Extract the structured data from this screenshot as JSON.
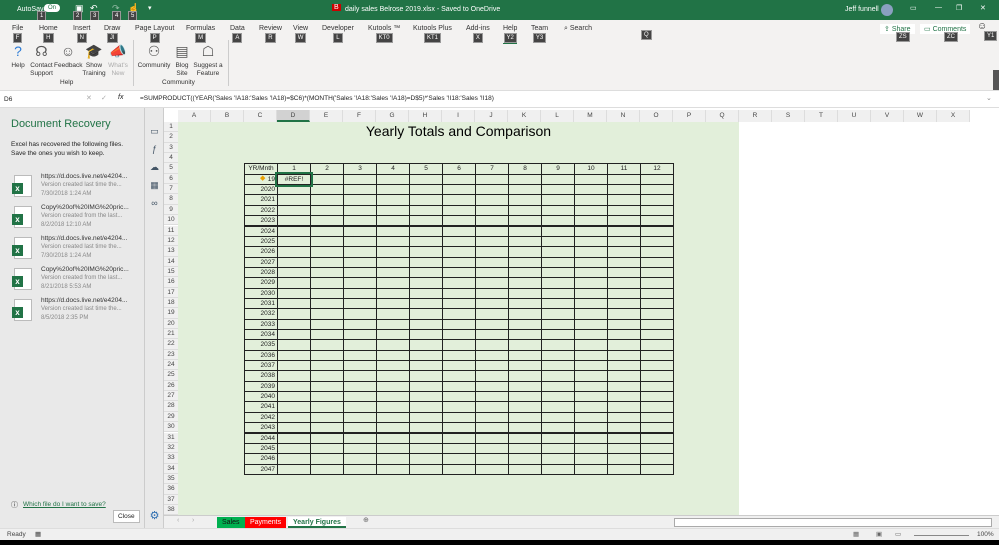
{
  "titlebar": {
    "autosave": "AutoSave",
    "autosave_state": "On",
    "doc_title": "daily sales Belrose 2019.xlsx - Saved to OneDrive",
    "user": "Jeff funnell",
    "keytips": [
      "1",
      "2",
      "3",
      "4",
      "5"
    ]
  },
  "ribbon": {
    "tabs": [
      {
        "label": "File",
        "key": "F"
      },
      {
        "label": "Home",
        "key": "H"
      },
      {
        "label": "Insert",
        "key": "N"
      },
      {
        "label": "Draw",
        "key": "JI"
      },
      {
        "label": "Page Layout",
        "key": "P"
      },
      {
        "label": "Formulas",
        "key": "M"
      },
      {
        "label": "Data",
        "key": "A"
      },
      {
        "label": "Review",
        "key": "R"
      },
      {
        "label": "View",
        "key": "W"
      },
      {
        "label": "Developer",
        "key": "L"
      },
      {
        "label": "Kutools ™",
        "key": "KT0"
      },
      {
        "label": "Kutools Plus",
        "key": "KT1"
      },
      {
        "label": "Add-ins",
        "key": "X"
      },
      {
        "label": "Help",
        "key": "Y2"
      },
      {
        "label": "Team",
        "key": "Y3"
      }
    ],
    "search": "Search",
    "search_key": "Q",
    "share": "Share",
    "share_key": "ZS",
    "comments": "Comments",
    "comments_key": "ZC",
    "smiley_key": "Y1",
    "help_group": {
      "label": "Help",
      "buttons": [
        "Help",
        "Contact Support",
        "Feedback",
        "Show Training",
        "What's New"
      ]
    },
    "community_group": {
      "label": "Community",
      "buttons": [
        "Community",
        "Blog Site",
        "Suggest a Feature"
      ]
    }
  },
  "formula_bar": {
    "name_box": "D6",
    "formula": "=SUMPRODUCT((YEAR('Sales '!A18:'Sales '!A18)=$C6)*(MONTH('Sales '!A18:'Sales '!A18)=D$5)*'Sales '!I18:'Sales '!I18)"
  },
  "recovery": {
    "title": "Document Recovery",
    "message": "Excel has recovered the following files.  Save the ones you wish to keep.",
    "files": [
      {
        "name": "https://d.docs.live.net/e4204...",
        "desc": "Version created last time the...",
        "time": "7/30/2018 1:24 AM"
      },
      {
        "name": "Copy%20of%20IMG%20pric...",
        "desc": "Version created from the last...",
        "time": "8/2/2018 12:10 AM"
      },
      {
        "name": "https://d.docs.live.net/e4204...",
        "desc": "Version created last time the...",
        "time": "7/30/2018 1:24 AM"
      },
      {
        "name": "Copy%20of%20IMG%20pric...",
        "desc": "Version created from the last...",
        "time": "8/21/2018 5:53 AM"
      },
      {
        "name": "https://d.docs.live.net/e4204...",
        "desc": "Version created last time the...",
        "time": "8/5/2018 2:35 PM"
      }
    ],
    "help_link": "Which file do I want to save?",
    "close": "Close"
  },
  "sheet": {
    "columns": [
      "A",
      "B",
      "C",
      "D",
      "E",
      "F",
      "G",
      "H",
      "I",
      "J",
      "K",
      "L",
      "M",
      "N",
      "O",
      "P",
      "Q",
      "R",
      "S",
      "T",
      "U",
      "V",
      "W",
      "X"
    ],
    "title": "Yearly Totals and Comparison",
    "header_label": "YR/Mnth",
    "months": [
      "1",
      "2",
      "3",
      "4",
      "5",
      "6",
      "7",
      "8",
      "9",
      "10",
      "11",
      "12"
    ],
    "years": [
      "19",
      "2020",
      "2021",
      "2022",
      "2023",
      "2024",
      "2025",
      "2026",
      "2027",
      "2028",
      "2029",
      "2030",
      "2031",
      "2032",
      "2033",
      "2034",
      "2035",
      "2036",
      "2037",
      "2038",
      "2039",
      "2040",
      "2041",
      "2042",
      "2043",
      "2044",
      "2045",
      "2046",
      "2047"
    ],
    "d6_value": "#REF!",
    "fill_color": "#e2efda"
  },
  "sheet_tabs": [
    {
      "label": "Sales",
      "color": "#00b050"
    },
    {
      "label": "Payments",
      "color": "#ff0000"
    },
    {
      "label": "Yearly Figures",
      "color": "#ffffff"
    }
  ],
  "status": {
    "ready": "Ready",
    "zoom": "100%"
  }
}
